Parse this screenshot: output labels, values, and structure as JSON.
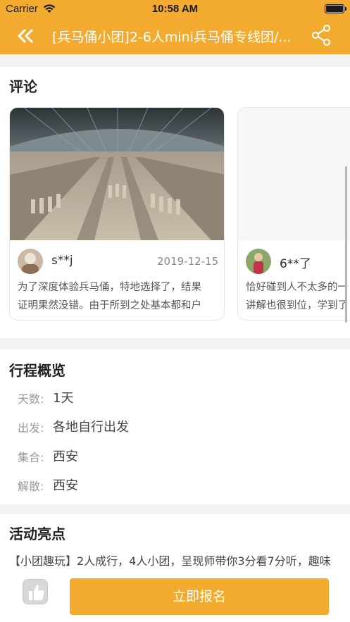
{
  "status_bar": {
    "carrier": "Carrier",
    "time": "10:58 AM"
  },
  "nav": {
    "title": "[兵马俑小团]2-6人mini兵马俑专线团/...",
    "back_icon": "back-arrow-icon",
    "share_icon": "share-icon"
  },
  "colors": {
    "accent": "#f2ab2f",
    "background": "#f2f2f2"
  },
  "reviews": {
    "title": "评论",
    "items": [
      {
        "user": "s**j",
        "date": "2019-12-15",
        "line1": "为了深度体验兵马俑，特地选择了，结果",
        "line2": "证明果然没错。由于所到之处基本都和户"
      },
      {
        "user": "6**了",
        "date": "",
        "line1": "恰好碰到人不太多的一",
        "line2": "讲解也很到位，学到了"
      }
    ]
  },
  "itinerary": {
    "title": "行程概览",
    "rows": [
      {
        "label": "天数:",
        "value": "1天"
      },
      {
        "label": "出发:",
        "value": "各地自行出发"
      },
      {
        "label": "集合:",
        "value": "西安"
      },
      {
        "label": "解散:",
        "value": "西安"
      }
    ]
  },
  "highlights": {
    "title": "活动亮点",
    "text": "【小团趣玩】2人成行，4人小团，呈现师带你3分看7分听，趣味"
  },
  "bottom_bar": {
    "like_icon": "thumbs-up-icon",
    "signup_label": "立即报名"
  }
}
